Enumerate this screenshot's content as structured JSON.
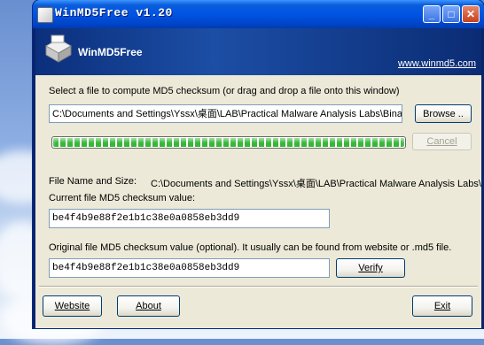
{
  "window": {
    "title": "WinMD5Free v1.20"
  },
  "banner": {
    "app_name": "WinMD5Free",
    "website_link": "www.winmd5.com"
  },
  "main": {
    "select_prompt": "Select a file to compute MD5 checksum (or drag and drop a file onto this window)",
    "file_path_value": "C:\\Documents and Settings\\Yssx\\桌面\\LAB\\Practical Malware Analysis Labs\\Binary",
    "browse_label": "Browse ..",
    "cancel_label": "Cancel",
    "progress_fraction": 1.0,
    "file_name_label": "File Name and Size:",
    "file_name_value": "C:\\Documents and Settings\\Yssx\\桌面\\LAB\\Practical Malware Analysis Labs\\Binary",
    "current_md5_label": "Current file MD5 checksum value:",
    "current_md5_value": "be4f4b9e88f2e1b1c38e0a0858eb3dd9",
    "original_md5_label": "Original file MD5 checksum value (optional). It usually can be found from website or .md5 file.",
    "original_md5_value": "be4f4b9e88f2e1b1c38e0a0858eb3dd9",
    "verify_label": "Verify"
  },
  "footer": {
    "website_label": "Website",
    "about_label": "About",
    "exit_label": "Exit"
  },
  "colors": {
    "titlebar": "#0054e3",
    "banner": "#1c4ea5",
    "dialog_bg": "#ece9d8",
    "progress": "#37b737"
  }
}
